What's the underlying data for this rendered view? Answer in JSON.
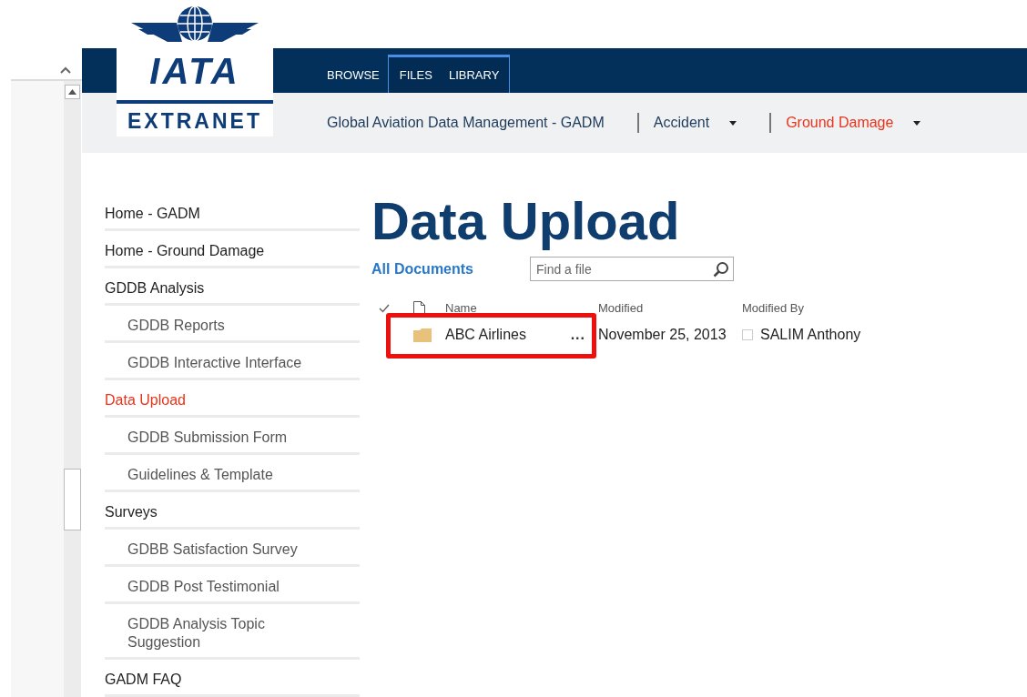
{
  "logo": {
    "wordmark": "IATA",
    "subtitle": "EXTRANET"
  },
  "ribbon_tabs": [
    {
      "label": "BROWSE",
      "contextual": false
    },
    {
      "label": "FILES",
      "contextual": true
    },
    {
      "label": "LIBRARY",
      "contextual": true
    }
  ],
  "top_nav": [
    {
      "label": "Global Aviation Data Management - GADM",
      "dropdown": false,
      "selected": false
    },
    {
      "label": "Accident",
      "dropdown": true,
      "selected": false
    },
    {
      "label": "Ground Damage",
      "dropdown": true,
      "selected": true
    }
  ],
  "sidebar": {
    "items": [
      {
        "label": "Home - GADM",
        "selected": false
      },
      {
        "label": "Home - Ground Damage",
        "selected": false
      },
      {
        "label": "GDDB Analysis",
        "selected": false,
        "children": [
          {
            "label": "GDDB Reports",
            "selected": false
          },
          {
            "label": "GDDB Interactive Interface",
            "selected": false
          }
        ]
      },
      {
        "label": "Data Upload",
        "selected": true,
        "children": [
          {
            "label": "GDDB Submission Form",
            "selected": false
          },
          {
            "label": "Guidelines & Template",
            "selected": false
          }
        ]
      },
      {
        "label": "Surveys",
        "selected": false,
        "children": [
          {
            "label": "GDBB Satisfaction Survey",
            "selected": false
          },
          {
            "label": "GDDB Post Testimonial",
            "selected": false
          },
          {
            "label": "GDDB Analysis Topic Suggestion",
            "selected": false
          }
        ]
      },
      {
        "label": "GADM FAQ",
        "selected": false
      }
    ]
  },
  "page_title": "Data Upload",
  "view_link": "All Documents",
  "search": {
    "placeholder": "Find a file"
  },
  "table": {
    "columns": [
      "Name",
      "Modified",
      "Modified By"
    ],
    "rows": [
      {
        "name": "ABC Airlines",
        "menu": "...",
        "modified": "November 25, 2013",
        "modified_by": "SALIM Anthony",
        "highlighted": true
      }
    ]
  }
}
